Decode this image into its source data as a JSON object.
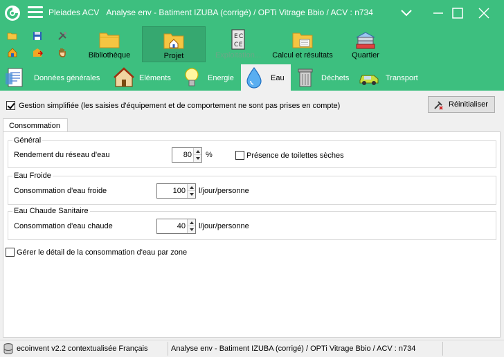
{
  "titlebar": {
    "app_name": "Pleiades ACV",
    "title": "Analyse env - Batiment  IZUBA (corrigé) / OPTi Vitrage Bbio / ACV : n734"
  },
  "ribbon": {
    "buttons": [
      {
        "label": "Bibliothèque",
        "icon": "folder-icon"
      },
      {
        "label": "Projet",
        "icon": "folder-house-icon"
      },
      {
        "label": "Exploitation...",
        "icon": "calculator-icon"
      },
      {
        "label": "Calcul et résultats",
        "icon": "folder-chart-icon"
      },
      {
        "label": "Quartier",
        "icon": "buildings-icon"
      }
    ]
  },
  "tabs": [
    {
      "label": "Données générales",
      "icon": "document-icon"
    },
    {
      "label": "Eléments",
      "icon": "house-icon"
    },
    {
      "label": "Energie",
      "icon": "lightbulb-icon"
    },
    {
      "label": "Eau",
      "icon": "water-drop-icon",
      "active": true
    },
    {
      "label": "Déchets",
      "icon": "trash-bin-icon"
    },
    {
      "label": "Transport",
      "icon": "car-icon"
    }
  ],
  "content": {
    "simplified_label": "Gestion simplifiée (les saisies d'équipement et de comportement ne sont pas prises en compte)",
    "simplified_checked": true,
    "reset_label": "Réinitialiser",
    "subtab_label": "Consommation",
    "general": {
      "title": "Général",
      "rendement_label": "Rendement du réseau d'eau",
      "rendement_value": "80",
      "rendement_unit": "%",
      "toilettes_label": "Présence de toilettes sèches",
      "toilettes_checked": false
    },
    "eau_froide": {
      "title": "Eau Froide",
      "label": "Consommation d'eau froide",
      "value": "100",
      "unit": "l/jour/personne"
    },
    "eau_chaude": {
      "title": "Eau Chaude Sanitaire",
      "label": "Consommation d'eau chaude",
      "value": "40",
      "unit": "l/jour/personne"
    },
    "zone_label": "Gérer le détail de la consommation d'eau par zone",
    "zone_checked": false
  },
  "statusbar": {
    "database": "ecoinvent v2.2 contextualisée Français",
    "project": "Analyse env - Batiment  IZUBA (corrigé) / OPTi Vitrage Bbio / ACV : n734"
  },
  "colors": {
    "accent": "#3dbf7f",
    "active_ribbon": "#36a870"
  }
}
